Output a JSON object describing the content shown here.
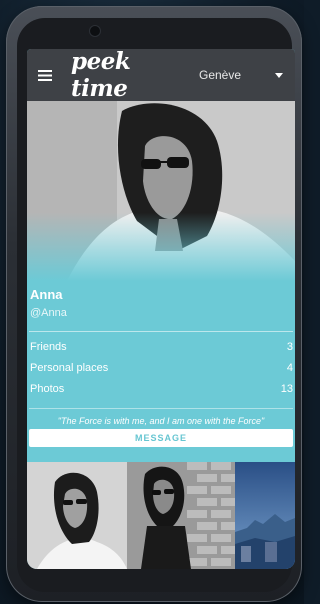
{
  "header": {
    "logo_text": "peek time",
    "city": "Genève"
  },
  "profile": {
    "name": "Anna",
    "handle": "@Anna",
    "stats": [
      {
        "label": "Friends",
        "value": "3"
      },
      {
        "label": "Personal places",
        "value": "4"
      },
      {
        "label": "Photos",
        "value": "13"
      }
    ],
    "quote": "\"The Force is with me, and I am one with the Force\"",
    "message_button": "MESSAGE"
  },
  "colors": {
    "accent": "#6ccad6",
    "topbar": "#3e4146",
    "text_light": "#ffffff"
  },
  "icons": {
    "menu": "hamburger-menu-icon",
    "dropdown": "caret-down-icon"
  }
}
